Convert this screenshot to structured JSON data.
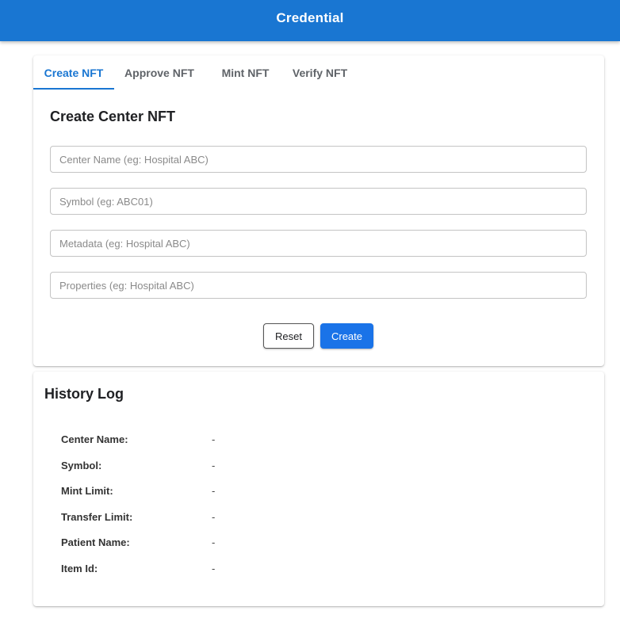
{
  "header": {
    "title": "Credential"
  },
  "tabs": [
    {
      "label": "Create NFT",
      "active": true
    },
    {
      "label": "Approve NFT",
      "active": false
    },
    {
      "label": "Mint NFT",
      "active": false
    },
    {
      "label": "Verify NFT",
      "active": false
    }
  ],
  "form": {
    "title": "Create Center NFT",
    "fields": [
      {
        "placeholder": "Center Name (eg: Hospital ABC)",
        "value": ""
      },
      {
        "placeholder": "Symbol (eg: ABC01)",
        "value": ""
      },
      {
        "placeholder": "Metadata (eg: Hospital ABC)",
        "value": ""
      },
      {
        "placeholder": "Properties (eg: Hospital ABC)",
        "value": ""
      }
    ],
    "reset_label": "Reset",
    "create_label": "Create"
  },
  "history": {
    "title": "History Log",
    "rows": [
      {
        "label": "Center Name:",
        "value": "-"
      },
      {
        "label": "Symbol:",
        "value": "-"
      },
      {
        "label": "Mint Limit:",
        "value": "-"
      },
      {
        "label": "Transfer Limit:",
        "value": "-"
      },
      {
        "label": "Patient Name:",
        "value": "-"
      },
      {
        "label": "Item Id:",
        "value": "-"
      }
    ]
  },
  "colors": {
    "primary": "#1976d2",
    "button_primary": "#1a73e8"
  }
}
